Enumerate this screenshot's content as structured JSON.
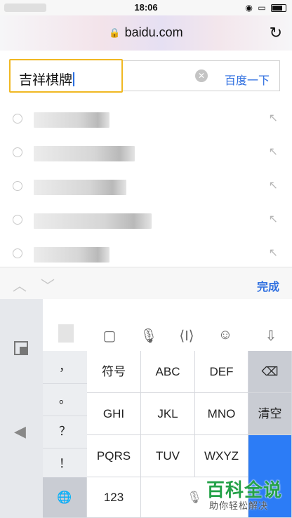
{
  "status_bar": {
    "time": "18:06"
  },
  "browser": {
    "domain": "baidu.com"
  },
  "search": {
    "query": "吉祥棋牌",
    "submit_label": "百度一下"
  },
  "suggestions": {
    "count_blurred": 5
  },
  "keyboard_toolbar": {
    "done_label": "完成"
  },
  "keyboard": {
    "punctuation": [
      "，",
      "。",
      "？",
      "！"
    ],
    "rows": [
      [
        "符号",
        "ABC",
        "DEF"
      ],
      [
        "GHI",
        "JKL",
        "MNO"
      ],
      [
        "PQRS",
        "TUV",
        "WXYZ"
      ],
      [
        "123",
        "",
        ""
      ]
    ],
    "clear_label": "清空",
    "blue_key_label": ""
  },
  "watermark": {
    "title": "百科全说",
    "subtitle": "助你轻松解决"
  },
  "colors": {
    "accent": "#2f6fe0",
    "focus_border": "#f0b823",
    "watermark": "#24a148"
  },
  "icons": [
    "lock-icon",
    "reload-icon",
    "clear-icon",
    "suggest-circle-icon",
    "suggest-arrow-icon",
    "chevron-up-icon",
    "chevron-down-icon",
    "keyboard-switch-icon",
    "back-arrow-icon",
    "emoji-list-icon",
    "microphone-icon",
    "cursor-icon",
    "smile-icon",
    "collapse-icon",
    "delete-icon",
    "globe-icon"
  ]
}
